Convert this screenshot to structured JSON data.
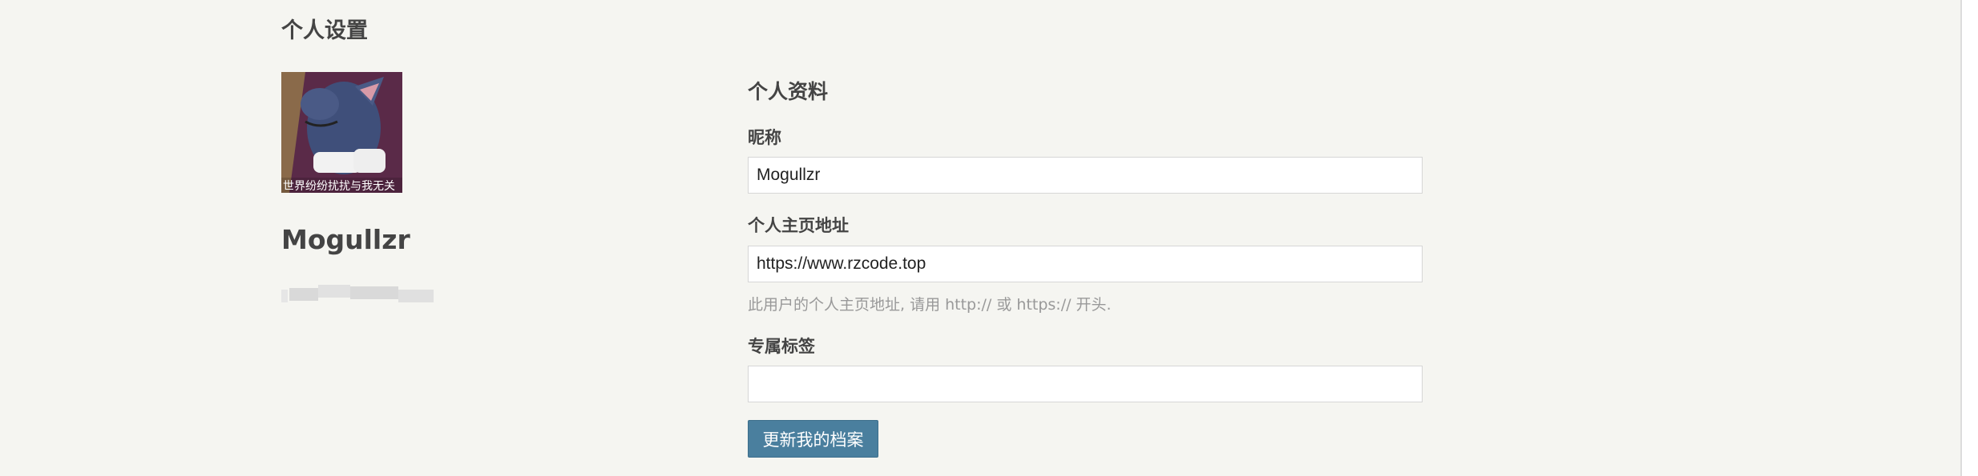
{
  "page": {
    "title": "个人设置"
  },
  "profile": {
    "avatar_caption": "世界纷纷扰扰与我无关",
    "name": "Mogullzr"
  },
  "form": {
    "section_title": "个人资料",
    "nickname": {
      "label": "昵称",
      "value": "Mogullzr"
    },
    "homepage": {
      "label": "个人主页地址",
      "value": "https://www.rzcode.top",
      "help": "此用户的个人主页地址, 请用 http:// 或 https:// 开头."
    },
    "tag": {
      "label": "专属标签",
      "value": ""
    },
    "submit_label": "更新我的档案"
  }
}
